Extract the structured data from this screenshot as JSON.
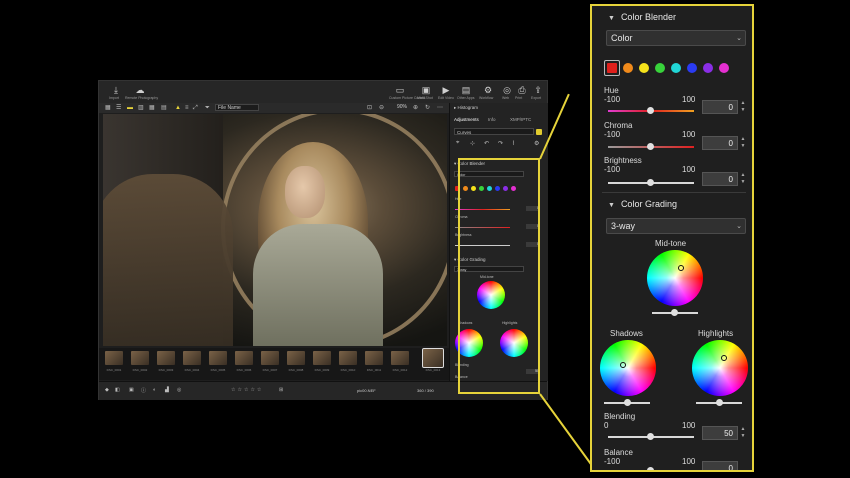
{
  "app": {
    "toolbar": {
      "left": [
        {
          "icon": "import-icon",
          "label": "Import"
        },
        {
          "icon": "remote-icon",
          "label": "Remote Photography"
        }
      ],
      "right": [
        {
          "icon": "picture-control-icon",
          "label": "Custom Picture Control"
        },
        {
          "icon": "multi-image-icon",
          "label": "Multi-Shot"
        },
        {
          "icon": "edit-video-icon",
          "label": "Edit Video"
        },
        {
          "icon": "other-apps-icon",
          "label": "Other Apps"
        },
        {
          "icon": "workflow-icon",
          "label": "Workflow"
        },
        {
          "icon": "web-icon",
          "label": "Web"
        },
        {
          "icon": "print-icon",
          "label": "Print"
        },
        {
          "icon": "export-icon",
          "label": "Export"
        }
      ]
    },
    "view_bar": {
      "sort": "File Name",
      "zoom": "90%"
    },
    "panel": {
      "histogram": "Histogram",
      "tabs": [
        "Adjustments",
        "Info",
        "XMP/IPTC"
      ],
      "curve_preset": "Curves",
      "color_blender": {
        "title": "Color Blender",
        "mode": "Color"
      },
      "color_grading": {
        "title": "Color Grading",
        "mode": "3-way"
      }
    },
    "filmstrip": {
      "thumbs": [
        "DSC_0001",
        "DSC_0002",
        "DSC_0003",
        "DSC_0004",
        "DSC_0005",
        "DSC_0006",
        "DSC_0007",
        "DSC_0008",
        "DSC_0009",
        "DSC_0010",
        "DSC_0011",
        "DSC_0012",
        "DSC_0013"
      ],
      "selected_index": 12
    },
    "status": {
      "file": "pic00.NEF",
      "position": "360 / 390"
    }
  },
  "zoom_panel": {
    "color_blender": {
      "title": "Color Blender",
      "mode": "Color",
      "swatches": [
        "#e0201c",
        "#f08a1b",
        "#f5e21b",
        "#38d33b",
        "#21d6d6",
        "#2a3bf2",
        "#8a2ee6",
        "#e42fd0"
      ],
      "selected_swatch": 0,
      "hue": {
        "label": "Hue",
        "min": "-100",
        "max": "100",
        "value": "0"
      },
      "chroma": {
        "label": "Chroma",
        "min": "-100",
        "max": "100",
        "value": "0"
      },
      "brightness": {
        "label": "Brightness",
        "min": "-100",
        "max": "100",
        "value": "0"
      }
    },
    "color_grading": {
      "title": "Color Grading",
      "mode": "3-way",
      "midtone": "Mid-tone",
      "shadows": "Shadows",
      "highlights": "Highlights",
      "blending": {
        "label": "Blending",
        "min": "0",
        "max": "100",
        "value": "50"
      },
      "balance": {
        "label": "Balance",
        "min": "-100",
        "max": "100",
        "value": "0"
      }
    }
  },
  "colors": {
    "accent": "#e6d33a"
  }
}
